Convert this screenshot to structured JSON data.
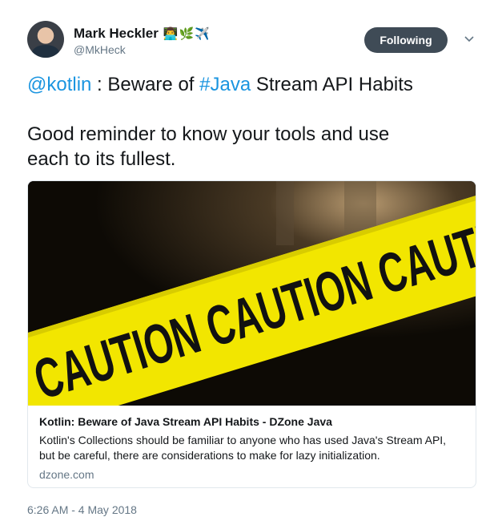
{
  "author": {
    "name": "Mark Heckler",
    "handle": "@MkHeck",
    "name_emoji": "👨‍💻🌿✈️"
  },
  "follow_button": {
    "label": "Following",
    "color": "#3f4b56"
  },
  "tweet": {
    "line1_mention": "@kotlin",
    "line1_middle": " : Beware of ",
    "line1_hashtag": "#Java",
    "line1_end": " Stream API Habits",
    "line2": "Good reminder to know your tools and use",
    "line3": "each to its fullest.",
    "link_color": "#1b95e0"
  },
  "card": {
    "image_text": "CAUTION CAUTION CAUTION",
    "title": "Kotlin: Beware of Java Stream API Habits - DZone Java",
    "description_line1": "Kotlin's Collections should be familiar to anyone who has used Java's Stream API,",
    "description_line2": "but be careful, there are considerations to make for lazy initialization.",
    "domain": "dzone.com"
  },
  "timestamp": "6:26 AM - 4 May 2018"
}
